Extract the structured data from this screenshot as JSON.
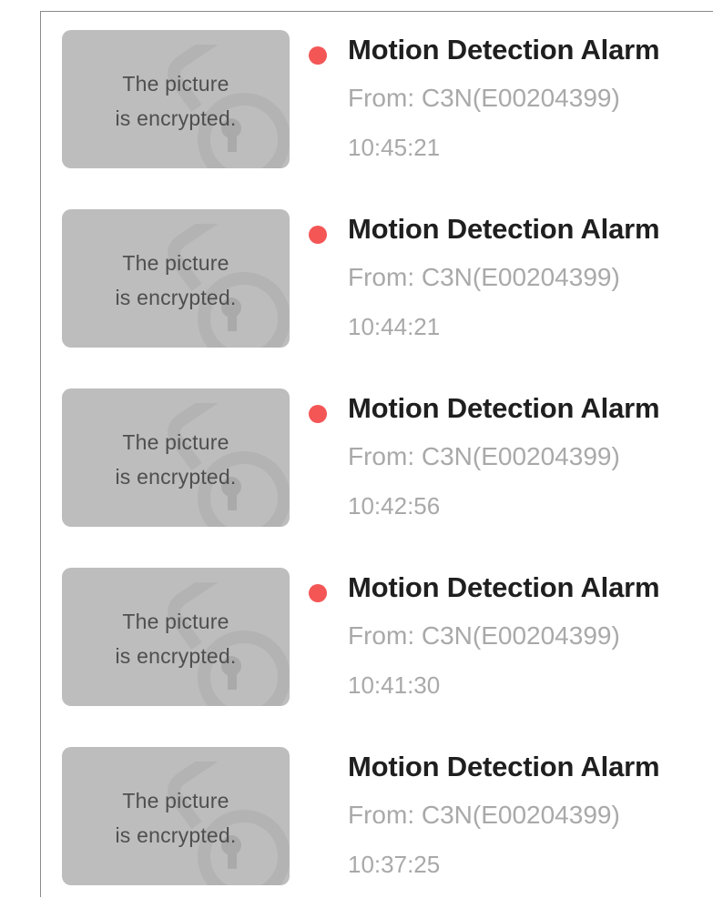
{
  "notifications": [
    {
      "thumbnail_line1": "The picture",
      "thumbnail_line2": "is encrypted.",
      "title": "Motion Detection Alarm",
      "from": "From: C3N(E00204399)",
      "time": "10:45:21",
      "unread": true
    },
    {
      "thumbnail_line1": "The picture",
      "thumbnail_line2": "is encrypted.",
      "title": "Motion Detection Alarm",
      "from": "From: C3N(E00204399)",
      "time": "10:44:21",
      "unread": true
    },
    {
      "thumbnail_line1": "The picture",
      "thumbnail_line2": "is encrypted.",
      "title": "Motion Detection Alarm",
      "from": "From: C3N(E00204399)",
      "time": "10:42:56",
      "unread": true
    },
    {
      "thumbnail_line1": "The picture",
      "thumbnail_line2": "is encrypted.",
      "title": "Motion Detection Alarm",
      "from": "From: C3N(E00204399)",
      "time": "10:41:30",
      "unread": true
    },
    {
      "thumbnail_line1": "The picture",
      "thumbnail_line2": "is encrypted.",
      "title": "Motion Detection Alarm",
      "from": "From: C3N(E00204399)",
      "time": "10:37:25",
      "unread": false
    }
  ],
  "colors": {
    "unread_dot": "#f45656",
    "thumbnail_bg": "#bdbdbd",
    "title_text": "#1f1f1f",
    "meta_text": "#a9a9a9"
  },
  "icons": {
    "thumbnail_watermark": "lock-icon",
    "unread_marker": "unread-dot"
  }
}
